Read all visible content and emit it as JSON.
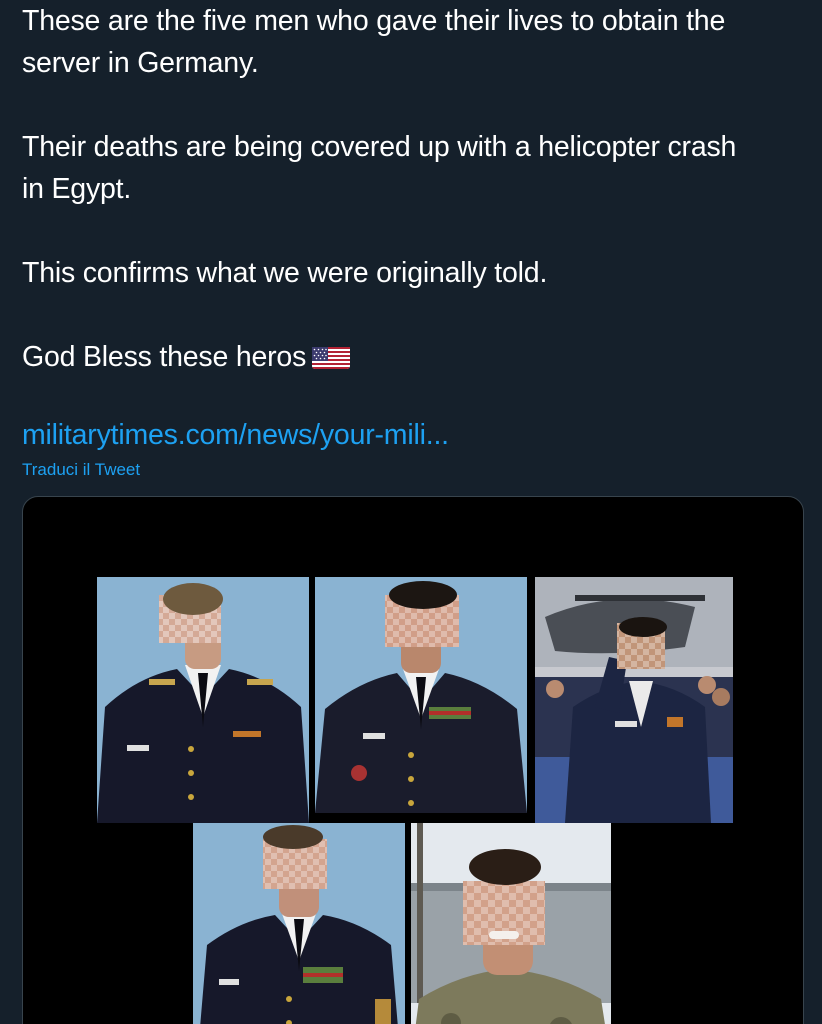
{
  "tweet": {
    "paragraphs": [
      "These are the five men who gave their lives to obtain the\nserver in Germany.",
      "Their deaths are being covered up with a helicopter crash\nin Egypt.",
      "This confirms what we were originally told.",
      "God Bless these heros"
    ],
    "emoji": "us-flag-icon",
    "link_text": "militarytimes.com/news/your-mili...",
    "translate_label": "Traduci il Tweet"
  },
  "media": {
    "photos": [
      "soldier-portrait-1",
      "soldier-portrait-2",
      "soldier-saluting",
      "soldier-portrait-4",
      "soldier-smiling-camo"
    ]
  },
  "colors": {
    "background": "#15202b",
    "text": "#ffffff",
    "link": "#1da1f2",
    "card_border": "#38444d"
  }
}
